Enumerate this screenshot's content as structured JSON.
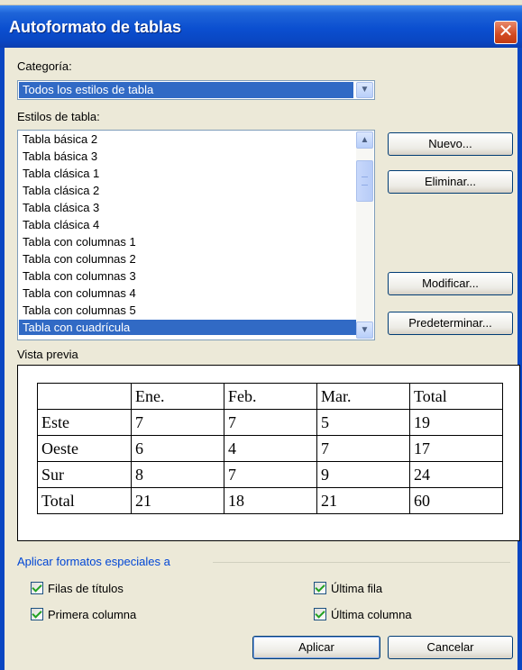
{
  "window": {
    "title": "Autoformato de tablas",
    "close_glyph": "✕"
  },
  "category": {
    "label": "Categoría:",
    "value": "Todos los estilos de tabla"
  },
  "styles": {
    "label": "Estilos de tabla:",
    "items": [
      "Tabla básica 2",
      "Tabla básica 3",
      "Tabla clásica 1",
      "Tabla clásica 2",
      "Tabla clásica 3",
      "Tabla clásica 4",
      "Tabla con columnas 1",
      "Tabla con columnas 2",
      "Tabla con columnas 3",
      "Tabla con columnas 4",
      "Tabla con columnas 5",
      "Tabla con cuadrícula"
    ],
    "selected": "Tabla con cuadrícula"
  },
  "buttons": {
    "new": "Nuevo...",
    "delete": "Eliminar...",
    "modify": "Modificar...",
    "default": "Predeterminar...",
    "apply": "Aplicar",
    "cancel": "Cancelar"
  },
  "preview": {
    "label": "Vista previa",
    "header": [
      "",
      "Ene.",
      "Feb.",
      "Mar.",
      "Total"
    ],
    "rows": [
      [
        "Este",
        "7",
        "7",
        "5",
        "19"
      ],
      [
        "Oeste",
        "6",
        "4",
        "7",
        "17"
      ],
      [
        "Sur",
        "8",
        "7",
        "9",
        "24"
      ],
      [
        "Total",
        "21",
        "18",
        "21",
        "60"
      ]
    ]
  },
  "special": {
    "label": "Aplicar formatos especiales a",
    "header_rows": {
      "label": "Filas de títulos",
      "checked": true
    },
    "first_column": {
      "label": "Primera columna",
      "checked": true
    },
    "last_row": {
      "label": "Última fila",
      "checked": true
    },
    "last_column": {
      "label": "Última columna",
      "checked": true
    }
  },
  "colors": {
    "title_bar": "#0a46c2",
    "selection": "#316ac5",
    "group_label": "#0046d5",
    "dialog_bg": "#ece9d8"
  }
}
